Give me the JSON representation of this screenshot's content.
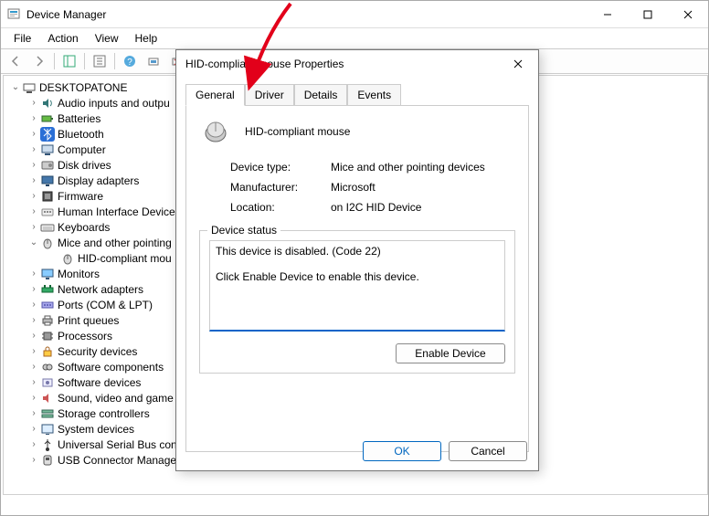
{
  "window": {
    "title": "Device Manager",
    "menu": [
      "File",
      "Action",
      "View",
      "Help"
    ]
  },
  "tree": {
    "root": "DESKTOPATONE",
    "items": [
      {
        "label": "Audio inputs and outpu",
        "icon": "audio",
        "expanded": false
      },
      {
        "label": "Batteries",
        "icon": "battery",
        "expanded": false
      },
      {
        "label": "Bluetooth",
        "icon": "bluetooth",
        "expanded": false
      },
      {
        "label": "Computer",
        "icon": "computer",
        "expanded": false
      },
      {
        "label": "Disk drives",
        "icon": "disk",
        "expanded": false
      },
      {
        "label": "Display adapters",
        "icon": "display",
        "expanded": false
      },
      {
        "label": "Firmware",
        "icon": "firmware",
        "expanded": false
      },
      {
        "label": "Human Interface Device",
        "icon": "hid",
        "expanded": false
      },
      {
        "label": "Keyboards",
        "icon": "keyboard",
        "expanded": false
      },
      {
        "label": "Mice and other pointing",
        "icon": "mouse",
        "expanded": true,
        "children": [
          {
            "label": "HID-compliant mou",
            "icon": "mouse"
          }
        ]
      },
      {
        "label": "Monitors",
        "icon": "monitor",
        "expanded": false
      },
      {
        "label": "Network adapters",
        "icon": "net",
        "expanded": false
      },
      {
        "label": "Ports (COM & LPT)",
        "icon": "port",
        "expanded": false
      },
      {
        "label": "Print queues",
        "icon": "print",
        "expanded": false
      },
      {
        "label": "Processors",
        "icon": "cpu",
        "expanded": false
      },
      {
        "label": "Security devices",
        "icon": "security",
        "expanded": false
      },
      {
        "label": "Software components",
        "icon": "swcomp",
        "expanded": false
      },
      {
        "label": "Software devices",
        "icon": "swdev",
        "expanded": false
      },
      {
        "label": "Sound, video and game",
        "icon": "sound",
        "expanded": false
      },
      {
        "label": "Storage controllers",
        "icon": "storage",
        "expanded": false
      },
      {
        "label": "System devices",
        "icon": "system",
        "expanded": false
      },
      {
        "label": "Universal Serial Bus cont",
        "icon": "usb",
        "expanded": false
      },
      {
        "label": "USB Connector Managers",
        "icon": "usbconn",
        "expanded": false
      }
    ]
  },
  "dialog": {
    "title": "HID-compliant mouse Properties",
    "tabs": [
      "General",
      "Driver",
      "Details",
      "Events"
    ],
    "active_tab": "General",
    "device_name": "HID-compliant mouse",
    "rows": {
      "type_label": "Device type:",
      "type_value": "Mice and other pointing devices",
      "mfr_label": "Manufacturer:",
      "mfr_value": "Microsoft",
      "loc_label": "Location:",
      "loc_value": "on I2C HID Device"
    },
    "status_legend": "Device status",
    "status_text": "This device is disabled. (Code 22)\n\nClick Enable Device to enable this device.",
    "enable_button": "Enable Device",
    "ok": "OK",
    "cancel": "Cancel"
  },
  "arrow_target": "Driver"
}
